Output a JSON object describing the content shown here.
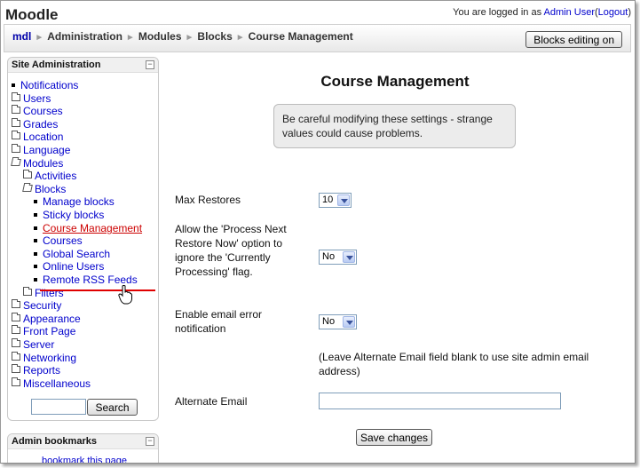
{
  "header": {
    "site_name": "Moodle",
    "login_prefix": "You are logged in as",
    "user_name": "Admin User",
    "logout_open": "(",
    "logout_label": "Logout",
    "logout_close": ")"
  },
  "navbar": {
    "breadcrumb": [
      "mdl",
      "Administration",
      "Modules",
      "Blocks",
      "Course Management"
    ],
    "separator": "►",
    "blocks_editing_button": "Blocks editing on"
  },
  "site_admin_block": {
    "title": "Site Administration",
    "toggle": "−",
    "items": [
      {
        "label": "Notifications",
        "icon": "bullet-icon"
      },
      {
        "label": "Users",
        "icon": "folder-icon"
      },
      {
        "label": "Courses",
        "icon": "folder-icon"
      },
      {
        "label": "Grades",
        "icon": "folder-icon"
      },
      {
        "label": "Location",
        "icon": "folder-icon"
      },
      {
        "label": "Language",
        "icon": "folder-icon"
      },
      {
        "label": "Modules",
        "icon": "folder-open-icon"
      },
      {
        "label": "Activities",
        "icon": "folder-icon"
      },
      {
        "label": "Blocks",
        "icon": "folder-open-icon"
      },
      {
        "label": "Manage blocks",
        "icon": "bullet-icon"
      },
      {
        "label": "Sticky blocks",
        "icon": "bullet-icon"
      },
      {
        "label": "Course Management",
        "icon": "bullet-icon",
        "active": true
      },
      {
        "label": "Courses",
        "icon": "bullet-icon"
      },
      {
        "label": "Global Search",
        "icon": "bullet-icon"
      },
      {
        "label": "Online Users",
        "icon": "bullet-icon"
      },
      {
        "label": "Remote RSS Feeds",
        "icon": "bullet-icon"
      },
      {
        "label": "Filters",
        "icon": "folder-icon"
      },
      {
        "label": "Security",
        "icon": "folder-icon"
      },
      {
        "label": "Appearance",
        "icon": "folder-icon"
      },
      {
        "label": "Front Page",
        "icon": "folder-icon"
      },
      {
        "label": "Server",
        "icon": "folder-icon"
      },
      {
        "label": "Networking",
        "icon": "folder-icon"
      },
      {
        "label": "Reports",
        "icon": "folder-icon"
      },
      {
        "label": "Miscellaneous",
        "icon": "folder-icon"
      }
    ],
    "search_value": "",
    "search_button": "Search"
  },
  "bookmarks_block": {
    "title": "Admin bookmarks",
    "toggle": "−",
    "link": "bookmark this page"
  },
  "main": {
    "title": "Course Management",
    "notice": "Be careful modifying these settings - strange values could cause problems.",
    "max_restores": {
      "label": "Max Restores",
      "value": "10"
    },
    "process_next": {
      "label": "Allow the 'Process Next Restore Now' option to ignore the 'Currently Processing' flag.",
      "value": "No"
    },
    "email_error": {
      "label": "Enable email error notification",
      "value": "No"
    },
    "alt_email_note": "(Leave Alternate Email field blank to use site admin email address)",
    "alt_email": {
      "label": "Alternate Email",
      "value": ""
    },
    "save_button": "Save changes"
  },
  "colors": {
    "link": "#0000cc",
    "active_link": "#cc0000",
    "notice_bg": "#ececec"
  }
}
